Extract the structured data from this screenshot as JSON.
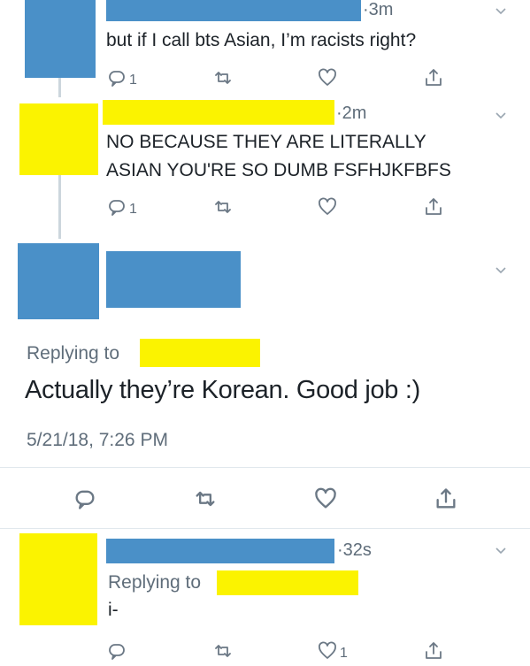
{
  "colors": {
    "censor_blue": "#4a90c8",
    "censor_yellow": "#fbf300",
    "icon_gray": "#6b7885"
  },
  "tweet1": {
    "time": "3m",
    "text": "but if I call bts Asian, I’m racists right?",
    "reply_count": "1",
    "icons": [
      "reply-icon",
      "retweet-icon",
      "like-icon",
      "share-icon"
    ]
  },
  "tweet2": {
    "time": "2m",
    "text_line1": "NO BECAUSE THEY ARE LITERALLY",
    "text_line2": "ASIAN YOU'RE SO DUMB FSFHJKFBFS",
    "reply_count": "1"
  },
  "focus_tweet": {
    "replying_label": "Replying to",
    "text": "Actually they’re Korean. Good job :)",
    "timestamp": "5/21/18, 7:26 PM"
  },
  "tweet4": {
    "time": "32s",
    "replying_label": "Replying to",
    "text": "i-",
    "like_count": "1"
  }
}
